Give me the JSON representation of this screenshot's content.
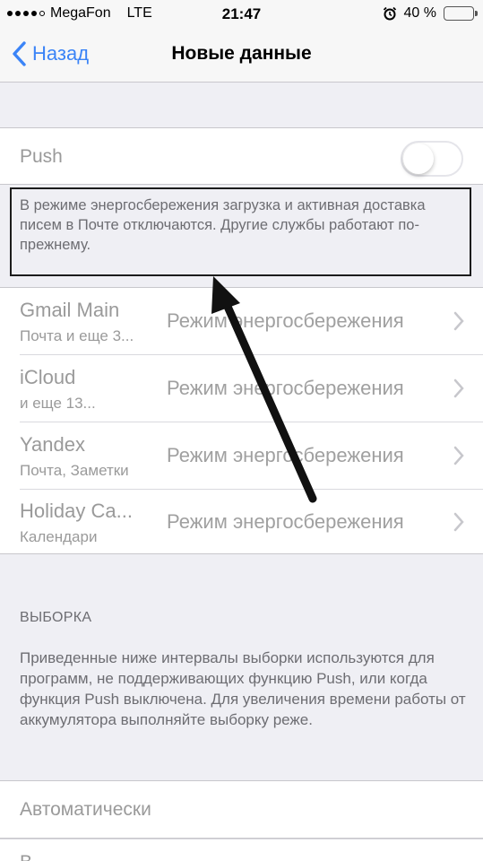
{
  "status": {
    "carrier": "MegaFon",
    "network": "LTE",
    "time": "21:47",
    "battery_text": "40 %",
    "battery_level": 0.4,
    "battery_color": "#f4c300"
  },
  "nav": {
    "back_label": "Назад",
    "title": "Новые данные",
    "accent": "#3b84f7"
  },
  "push": {
    "label": "Push",
    "enabled": false
  },
  "note": "В режиме энергосбережения загрузка и активная доставка писем в Почте отключаются. Другие службы работают по-прежнему.",
  "accounts": [
    {
      "name": "Gmail Main",
      "subtitle": "Почта и еще 3...",
      "value": "Режим энергосбережения"
    },
    {
      "name": "iCloud",
      "subtitle": " и еще 13...",
      "value": "Режим энергосбережения"
    },
    {
      "name": "Yandex",
      "subtitle": "Почта, Заметки",
      "value": "Режим энергосбережения"
    },
    {
      "name": "Holiday Ca...",
      "subtitle": "Календари",
      "value": "Режим энергосбережения"
    }
  ],
  "fetch": {
    "header": "ВЫБОРКА",
    "description": "Приведенные ниже интервалы выборки используются для программ, не поддерживающих функцию Push, или когда функция Push выключена. Для увеличения времени работы от аккумулятора выполняйте выборку реже.",
    "options": [
      "Автоматически",
      "В"
    ]
  }
}
